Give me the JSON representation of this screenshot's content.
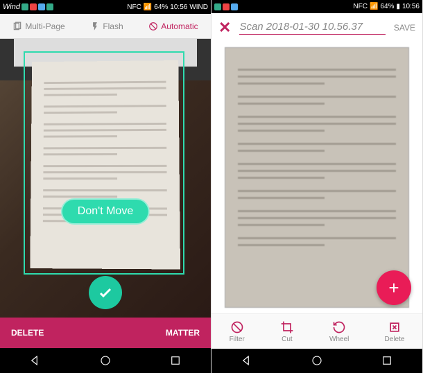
{
  "status_bar": {
    "carrier": "Wind",
    "battery": "64%",
    "time_left": "10:56",
    "carrier_right": "WIND",
    "time_right": "10:56"
  },
  "left": {
    "toolbar": {
      "multipage": "Multi-Page",
      "flash": "Flash",
      "automatic": "Automatic"
    },
    "overlay": "Don't Move",
    "bottom": {
      "delete": "DELETE",
      "matter": "MATTER"
    }
  },
  "right": {
    "title": "Scan 2018-01-30 10.56.37",
    "save": "SAVE",
    "bottom": {
      "filter": "Filter",
      "cut": "Cut",
      "wheel": "Wheel",
      "delete": "Delete"
    }
  }
}
